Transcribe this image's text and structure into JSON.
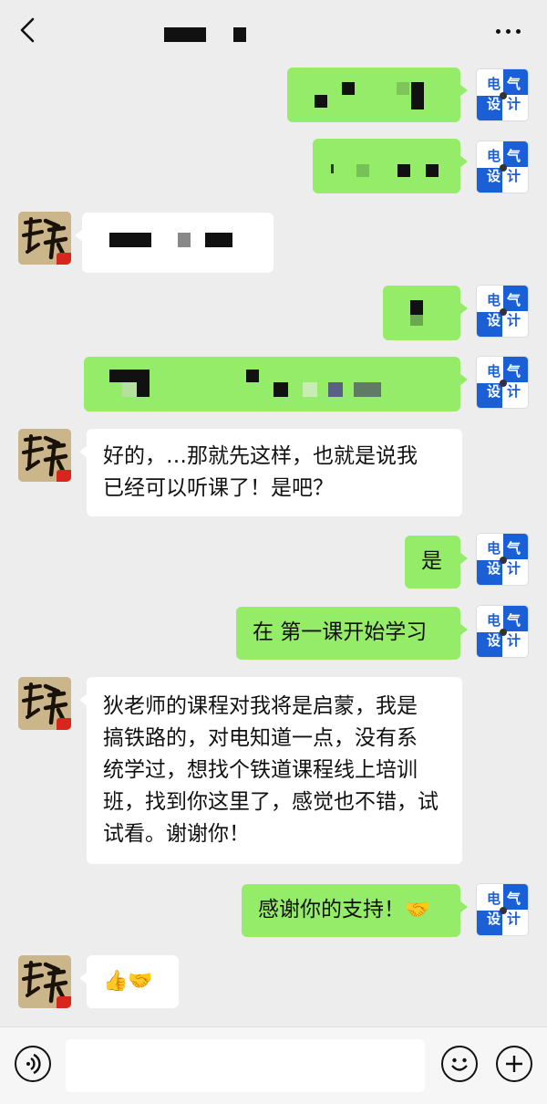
{
  "header": {
    "back_icon": "chevron-left-icon",
    "more_icon": "more-horizontal-icon"
  },
  "my_avatar": {
    "line1": "电气",
    "line2": "设计",
    "ch1": "电",
    "ch2": "气",
    "ch3": "设",
    "ch4": "计"
  },
  "messages": [
    {
      "sender": "me",
      "text": ""
    },
    {
      "sender": "me",
      "text": ""
    },
    {
      "sender": "other",
      "text": ""
    },
    {
      "sender": "me",
      "text": ""
    },
    {
      "sender": "me",
      "text": ""
    },
    {
      "sender": "other",
      "lines": [
        "好的，…那就先这样，也就是说我",
        "已经可以听课了！是吧？"
      ]
    },
    {
      "sender": "me",
      "text": "是"
    },
    {
      "sender": "me",
      "text": "在 第一课开始学习"
    },
    {
      "sender": "other",
      "lines": [
        "狄老师的课程对我将是启蒙，我是",
        "搞铁路的，对电知道一点，没有系",
        "统学过，想找个铁道课程线上培训",
        "班，找到你这里了，感觉也不错，试",
        "试看。谢谢你！"
      ]
    },
    {
      "sender": "me",
      "text": "感谢你的支持！",
      "emoji": "🤝"
    },
    {
      "sender": "other",
      "emoji": "👍🤝"
    }
  ],
  "input_bar": {
    "voice_icon": "voice-icon",
    "emoji_icon": "emoji-icon",
    "plus_icon": "plus-icon",
    "placeholder": ""
  },
  "colors": {
    "bg": "#ededed",
    "green_bubble": "#95ec69",
    "white_bubble": "#ffffff",
    "avatar_blue": "#1a5fd6"
  }
}
